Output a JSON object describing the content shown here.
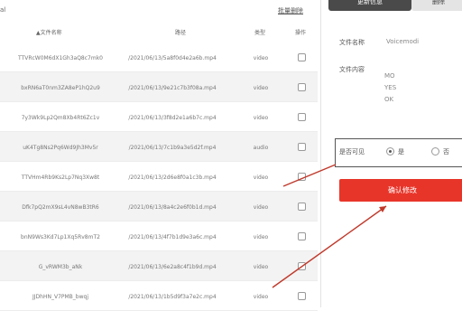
{
  "header": {
    "top_left": "al",
    "top_right_link": "批量删除"
  },
  "table": {
    "columns": [
      "▲文件名称",
      "路径",
      "类型",
      "操作"
    ],
    "rows": [
      {
        "name": "TTVRcW0M6dX1Gh3aQ8c7mk0",
        "path": "/2021/06/13/5a8f0d4e2a6b.mp4",
        "type": "video"
      },
      {
        "name": "bxRN6aT0nm3ZA8eP1hQ2u9",
        "path": "/2021/06/13/9e21c7b3f08a.mp4",
        "type": "video"
      },
      {
        "name": "7y3Wk9Lp2Qm8Xb4Rt6Zc1v",
        "path": "/2021/06/13/3f8d2e1a6b7c.mp4",
        "type": "video"
      },
      {
        "name": "uK4Tg8Ns2Pq6Wd9Jh3Mv5r",
        "path": "/2021/06/13/7c1b9a3e5d2f.mp4",
        "type": "audio"
      },
      {
        "name": "TTVHm4Rb9Ks2Lp7Nq3Xw8t",
        "path": "/2021/06/13/2d6e8f0a1c3b.mp4",
        "type": "video"
      },
      {
        "name": "Dfk7pQ2mX9sL4vN8wB3tR6",
        "path": "/2021/06/13/8a4c2e6f0b1d.mp4",
        "type": "video"
      },
      {
        "name": "bnN9Ws3Kd7Lp1Xq5Rv8mT2",
        "path": "/2021/06/13/4f7b1d9e3a6c.mp4",
        "type": "video"
      },
      {
        "name": "G_vRWM3b_aNk",
        "path": "/2021/06/13/6e2a8c4f1b9d.mp4",
        "type": "video"
      },
      {
        "name": "JJDhHN_V7PMB_bwqj",
        "path": "/2021/06/13/1b5d9f3a7e2c.mp4",
        "type": "video"
      }
    ]
  },
  "panel": {
    "tab_active": "更新信息",
    "tab_inactive": "删除",
    "name_label": "文件名称",
    "name_value": "Voicemodi",
    "content_label": "文件内容",
    "content_values": [
      "MO",
      "YES",
      "OK"
    ],
    "option_label": "是否可见",
    "option_yes": "是",
    "option_no": "否",
    "submit_label": "确认修改"
  },
  "colors": {
    "accent_red": "#e8352a",
    "tab_dark": "#4a4a4a",
    "row_alt": "#f3f3f3"
  }
}
